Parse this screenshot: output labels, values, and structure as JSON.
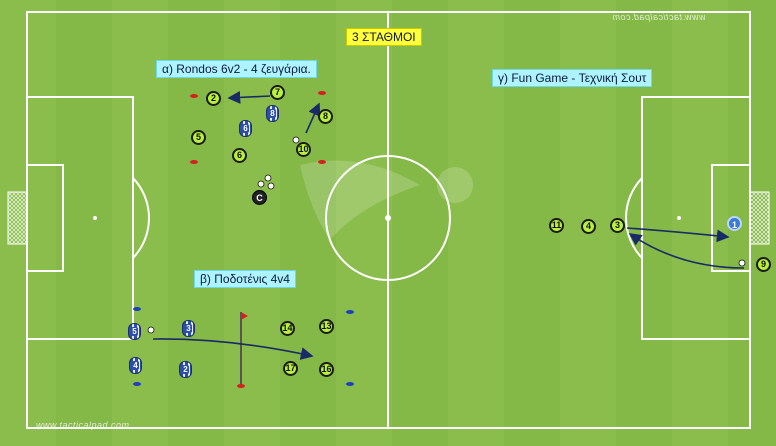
{
  "watermarks": {
    "top": "www.tacticalpad.com",
    "bottom": "www.tacticalpad.com"
  },
  "title": "3 ΣΤΑΘΜΟΙ",
  "stations": {
    "a": "α) Rondos 6v2 - 4 ζευγάρια.",
    "b": "β) Ποδοτένις 4v4",
    "c": "γ) Fun Game - Τεχνική Σουτ"
  },
  "players": {
    "rondo_green": [
      "2",
      "7",
      "8",
      "5",
      "6",
      "10"
    ],
    "rondo_blue": [
      "6",
      "8"
    ],
    "coach": "C",
    "footvolley_blue": [
      "5",
      "3",
      "4",
      "2"
    ],
    "footvolley_green": [
      "14",
      "13",
      "17",
      "16"
    ],
    "fun_green": [
      "11",
      "4",
      "3",
      "9"
    ],
    "keeper": "1"
  },
  "colors": {
    "grass_light": "#8bbd4c",
    "grass_dark": "#7fb343",
    "label_cyan": "#aef4ff",
    "label_yellow": "#ffff3a",
    "arrow": "#1a2a66"
  }
}
